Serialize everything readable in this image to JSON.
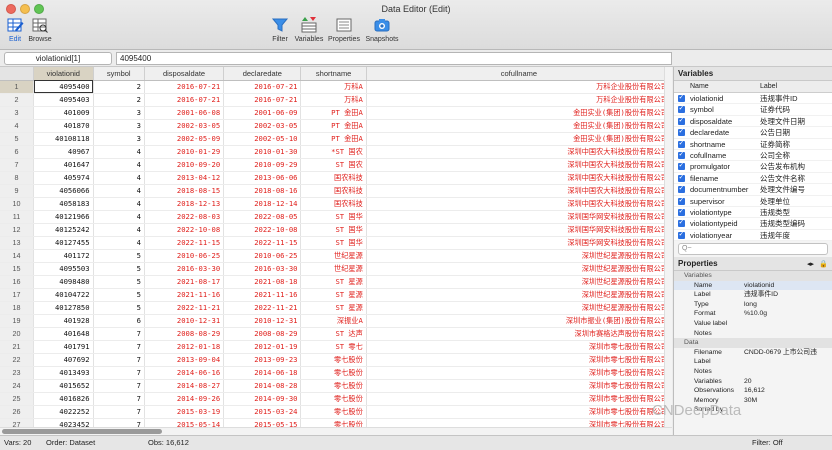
{
  "window": {
    "title": "Data Editor (Edit)"
  },
  "toolbar": {
    "edit_label": "Edit",
    "browse_label": "Browse",
    "filter_label": "Filter",
    "variables_label": "Variables",
    "properties_label": "Properties",
    "snapshots_label": "Snapshots"
  },
  "cellbar": {
    "cell_ref": "violationid[1]",
    "value": "4095400"
  },
  "grid": {
    "columns": [
      "violationid",
      "symbol",
      "disposaldate",
      "declaredate",
      "shortname",
      "cofullname"
    ],
    "rows": [
      [
        "1",
        "4095400",
        "2",
        "2016-07-21",
        "2016-07-21",
        "万科A",
        "万科企业股份有限公司"
      ],
      [
        "2",
        "4095403",
        "2",
        "2016-07-21",
        "2016-07-21",
        "万科A",
        "万科企业股份有限公司"
      ],
      [
        "3",
        "401009",
        "3",
        "2001-06-08",
        "2001-06-09",
        "PT 金田A",
        "金田实业(集团)股份有限公司"
      ],
      [
        "4",
        "401870",
        "3",
        "2002-03-05",
        "2002-03-05",
        "PT 金田A",
        "金田实业(集团)股份有限公司"
      ],
      [
        "5",
        "40108118",
        "3",
        "2002-05-09",
        "2002-05-10",
        "PT 金田A",
        "金田实业(集团)股份有限公司"
      ],
      [
        "6",
        "40967",
        "4",
        "2010-01-29",
        "2010-01-30",
        "*ST 国农",
        "深圳中国农大科技股份有限公司"
      ],
      [
        "7",
        "401647",
        "4",
        "2010-09-20",
        "2010-09-29",
        "ST 国农",
        "深圳中国农大科技股份有限公司"
      ],
      [
        "8",
        "405974",
        "4",
        "2013-04-12",
        "2013-06-06",
        "国农科技",
        "深圳中国农大科技股份有限公司"
      ],
      [
        "9",
        "4056066",
        "4",
        "2018-08-15",
        "2018-08-16",
        "国农科技",
        "深圳中国农大科技股份有限公司"
      ],
      [
        "10",
        "4058183",
        "4",
        "2018-12-13",
        "2018-12-14",
        "国农科技",
        "深圳中国农大科技股份有限公司"
      ],
      [
        "11",
        "40121966",
        "4",
        "2022-08-03",
        "2022-08-05",
        "ST 国华",
        "深圳国华网安科技股份有限公司"
      ],
      [
        "12",
        "40125242",
        "4",
        "2022-10-08",
        "2022-10-08",
        "ST 国华",
        "深圳国华网安科技股份有限公司"
      ],
      [
        "13",
        "40127455",
        "4",
        "2022-11-15",
        "2022-11-15",
        "ST 国华",
        "深圳国华网安科技股份有限公司"
      ],
      [
        "14",
        "401172",
        "5",
        "2010-06-25",
        "2010-06-25",
        "世纪星源",
        "深圳世纪星源股份有限公司"
      ],
      [
        "15",
        "4095503",
        "5",
        "2016-03-30",
        "2016-03-30",
        "世纪星源",
        "深圳世纪星源股份有限公司"
      ],
      [
        "16",
        "4098480",
        "5",
        "2021-08-17",
        "2021-08-18",
        "ST 星源",
        "深圳世纪星源股份有限公司"
      ],
      [
        "17",
        "40104722",
        "5",
        "2021-11-16",
        "2021-11-16",
        "ST 星源",
        "深圳世纪星源股份有限公司"
      ],
      [
        "18",
        "40127850",
        "5",
        "2022-11-21",
        "2022-11-21",
        "ST 星源",
        "深圳世纪星源股份有限公司"
      ],
      [
        "19",
        "401928",
        "6",
        "2010-12-31",
        "2010-12-31",
        "深振业A",
        "深圳市振业(集团)股份有限公司"
      ],
      [
        "20",
        "401648",
        "7",
        "2008-08-29",
        "2008-08-29",
        "ST 达声",
        "深圳市赛格达声股份有限公司"
      ],
      [
        "21",
        "401791",
        "7",
        "2012-01-18",
        "2012-01-19",
        "ST 零七",
        "深圳市零七股份有限公司"
      ],
      [
        "22",
        "407692",
        "7",
        "2013-09-04",
        "2013-09-23",
        "零七股份",
        "深圳市零七股份有限公司"
      ],
      [
        "23",
        "4013493",
        "7",
        "2014-06-16",
        "2014-06-18",
        "零七股份",
        "深圳市零七股份有限公司"
      ],
      [
        "24",
        "4015652",
        "7",
        "2014-08-27",
        "2014-08-28",
        "零七股份",
        "深圳市零七股份有限公司"
      ],
      [
        "25",
        "4016826",
        "7",
        "2014-09-26",
        "2014-09-30",
        "零七股份",
        "深圳市零七股份有限公司"
      ],
      [
        "26",
        "4022252",
        "7",
        "2015-03-19",
        "2015-03-24",
        "零七股份",
        "深圳市零七股份有限公司"
      ],
      [
        "27",
        "4023452",
        "7",
        "2015-05-14",
        "2015-05-15",
        "零七股份",
        "深圳市零七股份有限公司"
      ]
    ]
  },
  "status": {
    "vars": "Vars: 20",
    "order": "Order: Dataset",
    "obs": "Obs: 16,612",
    "filter": "Filter: Off"
  },
  "variables_panel": {
    "title": "Variables",
    "col_name": "Name",
    "col_label": "Label",
    "items": [
      {
        "name": "violationid",
        "label": "违规事件ID"
      },
      {
        "name": "symbol",
        "label": "证券代码"
      },
      {
        "name": "disposaldate",
        "label": "处理文件日期"
      },
      {
        "name": "declaredate",
        "label": "公告日期"
      },
      {
        "name": "shortname",
        "label": "证券简称"
      },
      {
        "name": "cofullname",
        "label": "公司全称"
      },
      {
        "name": "promulgator",
        "label": "公告发布机构"
      },
      {
        "name": "filename",
        "label": "公告文件名称"
      },
      {
        "name": "documentnumber",
        "label": "处理文件编号"
      },
      {
        "name": "supervisor",
        "label": "处理单位"
      },
      {
        "name": "violationtype",
        "label": "违规类型"
      },
      {
        "name": "violationtypeid",
        "label": "违规类型编码"
      },
      {
        "name": "violationyear",
        "label": "违规年度"
      }
    ],
    "search_placeholder": "Q~"
  },
  "properties_panel": {
    "title": "Properties",
    "variables_section": "Variables",
    "rows": [
      {
        "k": "Name",
        "v": "violationid"
      },
      {
        "k": "Label",
        "v": "违规事件ID"
      },
      {
        "k": "Type",
        "v": "long"
      },
      {
        "k": "Format",
        "v": "%10.0g"
      },
      {
        "k": "Value label",
        "v": ""
      },
      {
        "k": "Notes",
        "v": ""
      }
    ],
    "data_section": "Data",
    "data_rows": [
      {
        "k": "Filename",
        "v": "CNDD-0679 上市公司违"
      },
      {
        "k": "Label",
        "v": ""
      },
      {
        "k": "Notes",
        "v": ""
      },
      {
        "k": "Variables",
        "v": "20"
      },
      {
        "k": "Observations",
        "v": "16,612"
      },
      {
        "k": "Memory",
        "v": "30M"
      },
      {
        "k": "Sorted by",
        "v": ""
      }
    ]
  },
  "watermark": "CNDeepData",
  "colors": {
    "data_red": "#e0201c",
    "accent": "#1a5fd0",
    "selected_header": "#d9d3c3"
  }
}
